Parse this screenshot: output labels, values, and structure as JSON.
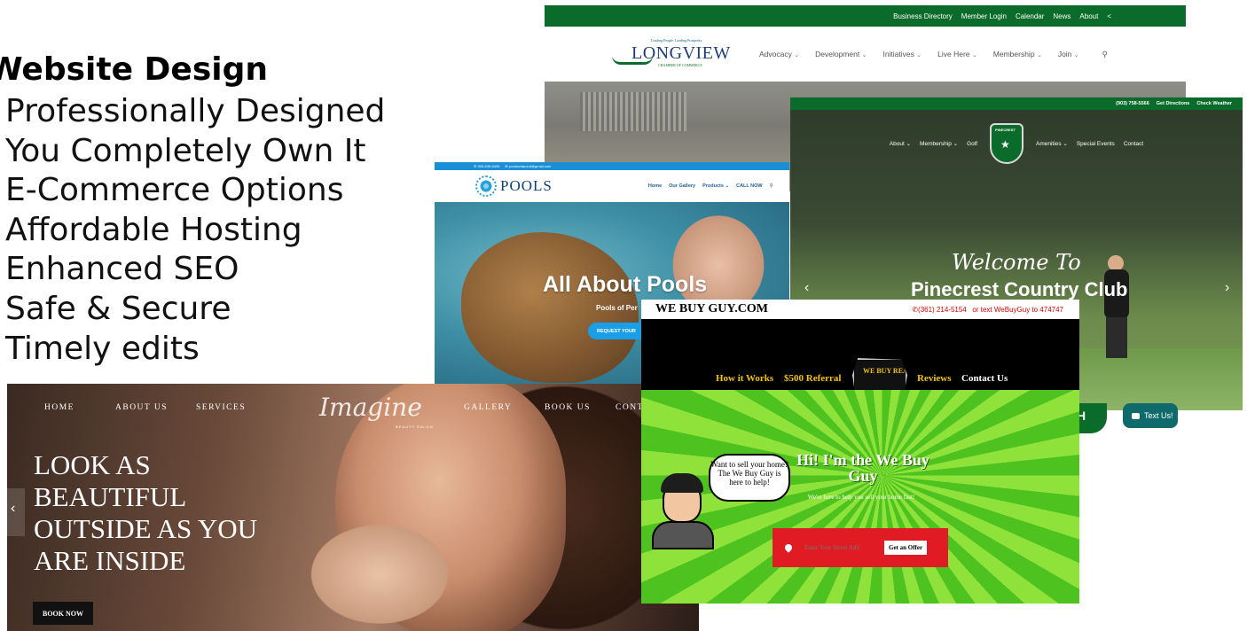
{
  "features": {
    "heading": "Website Design",
    "items": [
      "Professionally Designed",
      "You Completely Own It",
      "E-Commerce Options",
      "Affordable Hosting",
      "Enhanced SEO",
      "Safe & Secure",
      "Timely edits"
    ]
  },
  "longview": {
    "topbar": [
      "Business Directory",
      "Member Login",
      "Calendar",
      "News",
      "About",
      "<"
    ],
    "logo_tag": "Leading People. Leading Prosperity.",
    "logo_name": "LONGVIEW",
    "logo_sub": "CHAMBER OF COMMERCE",
    "nav": [
      "Advocacy",
      "Development",
      "Initiatives",
      "Live Here",
      "Membership",
      "Join"
    ],
    "brand_color": "#0b6b2a"
  },
  "pools": {
    "topbar_phone": "903-639-6439",
    "topbar_email": "poolsandpond@gmail.com",
    "logo_small": "ALL ABOUT",
    "logo": "POOLS",
    "nav": [
      "Home",
      "Our Gallery",
      "Products",
      "CALL NOW"
    ],
    "title": "All About Pools",
    "subtitle": "Pools of Per",
    "button": "REQUEST YOUR",
    "accent": "#1b9ee8"
  },
  "pinecrest": {
    "topbar": [
      "(903) 758-5566",
      "Get Directions",
      "Check Weather"
    ],
    "nav_left": [
      "About",
      "Membership",
      "Golf"
    ],
    "nav_right": [
      "Amenities",
      "Special Events",
      "Contact"
    ],
    "crest_label": "PINECREST",
    "welcome": "Welcome To",
    "title": "Pinecrest Country Club",
    "peek_letter": "H",
    "text_us": "Text Us!"
  },
  "imagine": {
    "nav": [
      "HOME",
      "ABOUT US",
      "SERVICES",
      "GALLERY",
      "BOOK US",
      "CONT"
    ],
    "logo": "Imagine",
    "logo_sub": "BEAUTY SALON",
    "headline": "LOOK AS BEAUTIFUL OUTSIDE AS YOU ARE INSIDE",
    "button": "BOOK NOW"
  },
  "webuy": {
    "brand": "WE BUY GUY.COM",
    "phone": "(361) 214-5154",
    "text_offer": "or text WeBuyGuy to 474747",
    "nav": [
      "How it Works",
      "$500 Referral",
      "Reviews",
      "Contact Us"
    ],
    "badge": "WE BUY REAL ESTATE",
    "bubble": "Want to sell your home? The We Buy Guy is here to help!",
    "title": "Hi! I'm the We Buy Guy",
    "subtitle": "We're here to help you sell your home fast!",
    "input_placeholder": "Enter Your Street Add",
    "offer_button": "Get an Offer",
    "accent": "#e01b24"
  }
}
